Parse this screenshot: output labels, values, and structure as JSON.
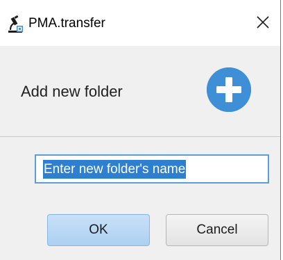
{
  "window": {
    "title": "PMA.transfer",
    "app_icon": "microscope-icon",
    "close_icon": "close-icon"
  },
  "header": {
    "text": "Add new folder",
    "icon": "plus-circle-icon",
    "icon_color": "#3e8fd6"
  },
  "form": {
    "folder_name_value": "Enter new folder's name",
    "accent_color": "#5a9fd8"
  },
  "buttons": {
    "ok_label": "OK",
    "cancel_label": "Cancel"
  }
}
